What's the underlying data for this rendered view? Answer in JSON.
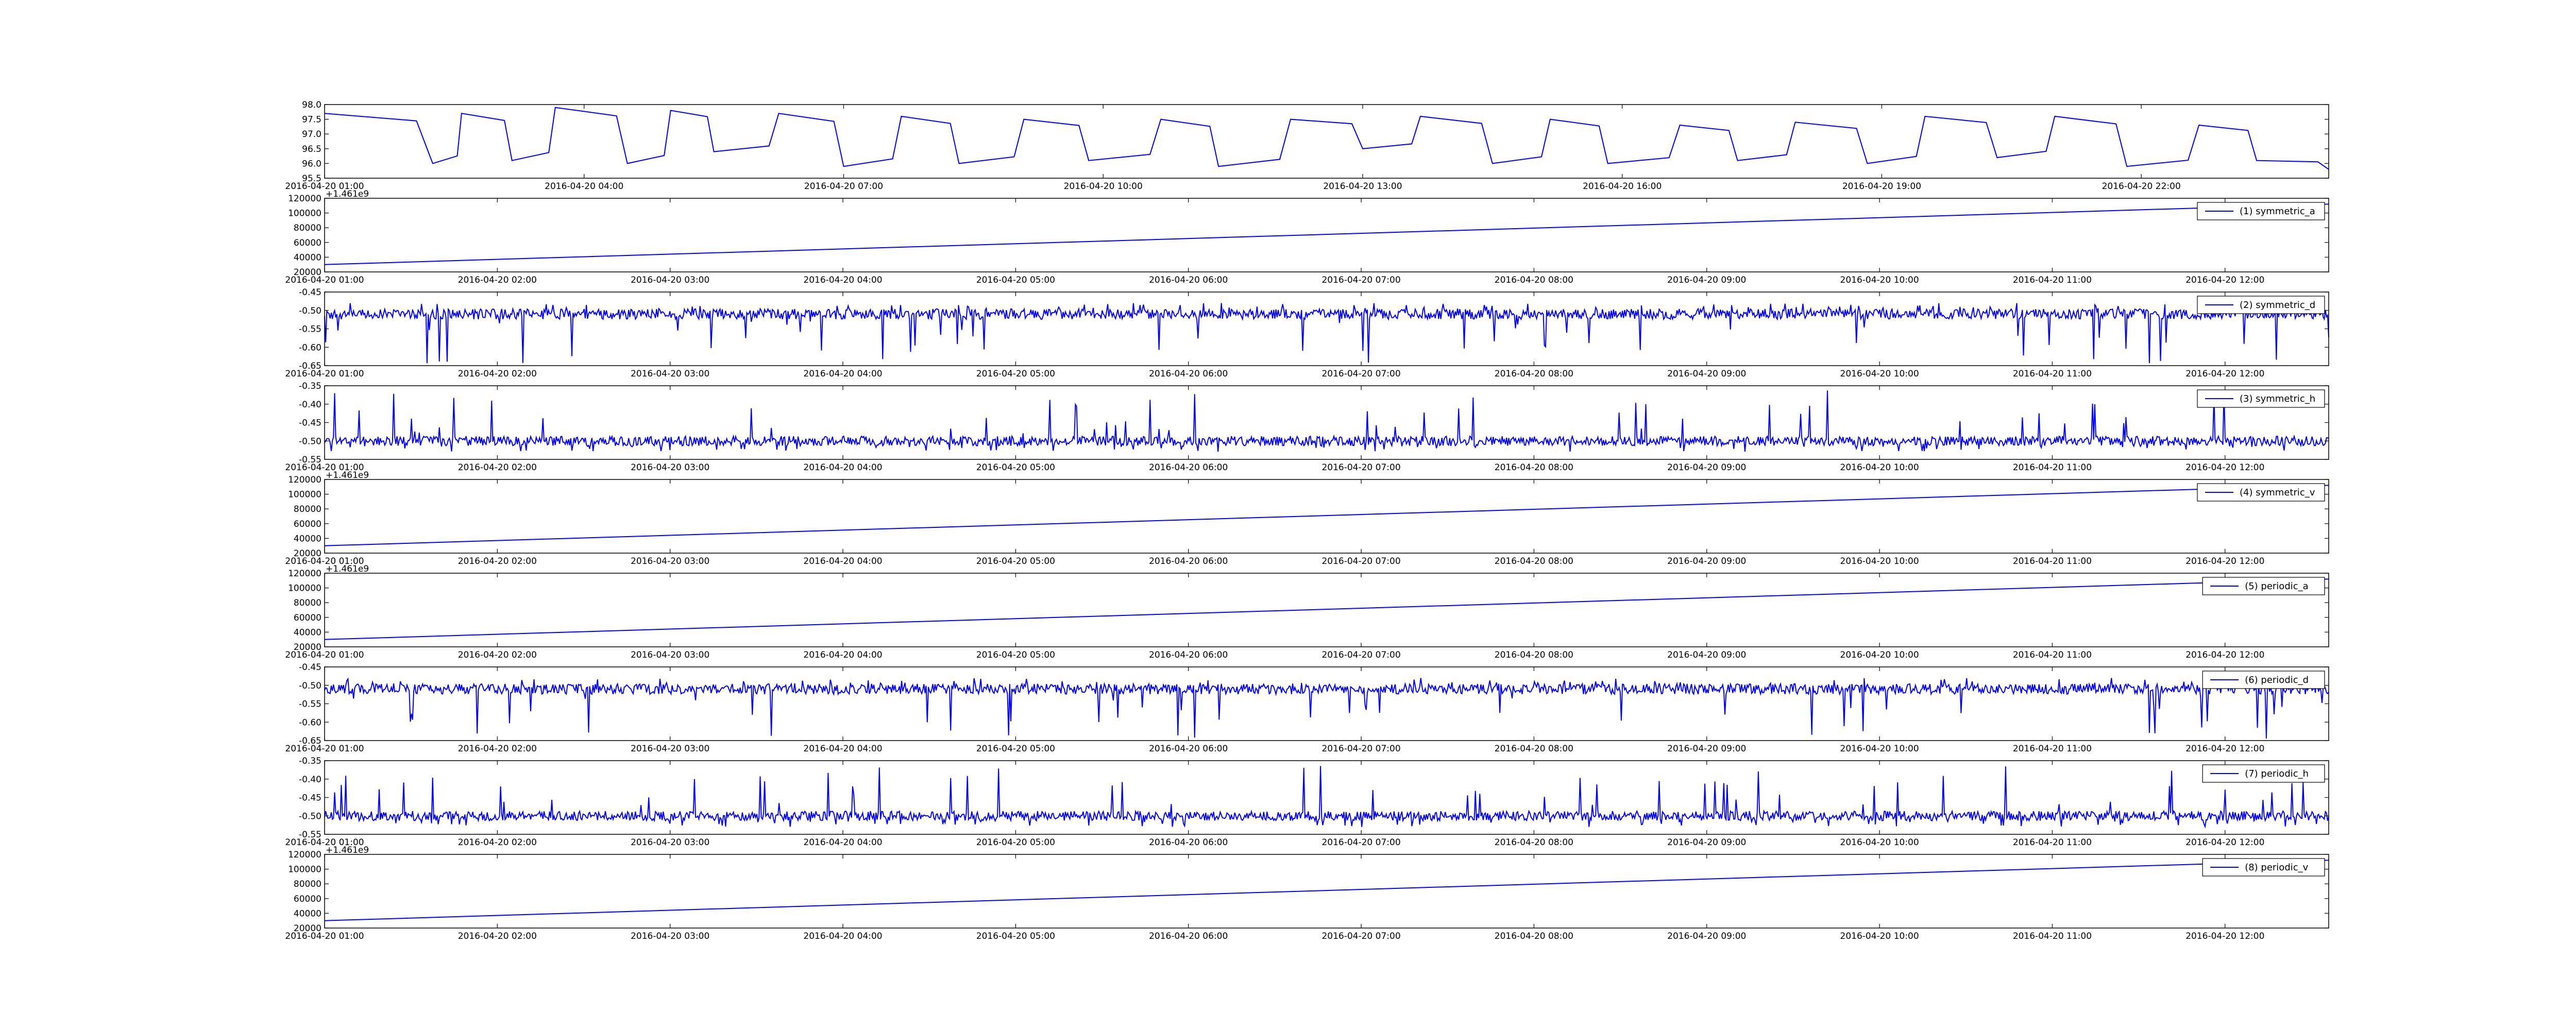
{
  "chart_data": [
    {
      "type": "line",
      "x_tick_labels": [
        "2016-04-20 01:00",
        "2016-04-20 04:00",
        "2016-04-20 07:00",
        "2016-04-20 10:00",
        "2016-04-20 13:00",
        "2016-04-20 16:00",
        "2016-04-20 19:00",
        "2016-04-20 22:00"
      ],
      "x_range": [
        "2016-04-20 01:00",
        "2016-04-21 00:10"
      ],
      "ylim": [
        95.5,
        98.0
      ],
      "y_tick_labels": [
        "95.5",
        "96.0",
        "96.5",
        "97.0",
        "97.5",
        "98.0"
      ],
      "offset_label": "",
      "legend": null,
      "series": [
        {
          "color": "#0000ff",
          "x": [
            "2016-04-20 01:00",
            "2016-04-20 02:15",
            "2016-04-20 02:35",
            "2016-04-20 03:10",
            "2016-04-20 03:40",
            "2016-04-20 04:30",
            "2016-04-20 05:00",
            "2016-04-20 05:30",
            "2016-04-20 06:15",
            "2016-04-20 07:00",
            "2016-04-20 07:40",
            "2016-04-20 08:20",
            "2016-04-20 09:05",
            "2016-04-20 09:50",
            "2016-04-20 10:40",
            "2016-04-20 11:20",
            "2016-04-20 12:10",
            "2016-04-20 13:00",
            "2016-04-20 13:40",
            "2016-04-20 14:30",
            "2016-04-20 15:10",
            "2016-04-20 15:50",
            "2016-04-20 16:40",
            "2016-04-20 17:20",
            "2016-04-20 18:00",
            "2016-04-20 18:50",
            "2016-04-20 19:30",
            "2016-04-20 20:20",
            "2016-04-20 21:00",
            "2016-04-20 21:50",
            "2016-04-20 22:40",
            "2016-04-20 23:20",
            "2016-04-21 00:10"
          ],
          "y": [
            97.7,
            96.0,
            97.7,
            96.1,
            97.9,
            96.0,
            97.8,
            96.4,
            97.7,
            95.9,
            97.6,
            96.0,
            97.5,
            96.1,
            97.5,
            95.9,
            97.5,
            96.5,
            97.6,
            96.0,
            97.5,
            96.0,
            97.3,
            96.1,
            97.4,
            96.0,
            97.6,
            96.2,
            97.6,
            95.9,
            97.3,
            96.1,
            95.8
          ]
        }
      ]
    },
    {
      "type": "line",
      "x_tick_labels": [
        "2016-04-20 01:00",
        "2016-04-20 02:00",
        "2016-04-20 03:00",
        "2016-04-20 04:00",
        "2016-04-20 05:00",
        "2016-04-20 06:00",
        "2016-04-20 07:00",
        "2016-04-20 08:00",
        "2016-04-20 09:00",
        "2016-04-20 10:00",
        "2016-04-20 11:00",
        "2016-04-20 12:00"
      ],
      "x_range": [
        "2016-04-20 01:00",
        "2016-04-20 12:36"
      ],
      "ylim": [
        20000,
        120000
      ],
      "y_tick_labels": [
        "20000",
        "40000",
        "60000",
        "80000",
        "100000",
        "120000"
      ],
      "offset_label": "+1.461e9",
      "legend": "(1) symmetric_a",
      "series": [
        {
          "color": "#0000ff",
          "x": [
            "2016-04-20 01:00",
            "2016-04-20 12:36"
          ],
          "y": [
            30000,
            112000
          ]
        }
      ]
    },
    {
      "type": "line",
      "x_tick_labels": [
        "2016-04-20 01:00",
        "2016-04-20 02:00",
        "2016-04-20 03:00",
        "2016-04-20 04:00",
        "2016-04-20 05:00",
        "2016-04-20 06:00",
        "2016-04-20 07:00",
        "2016-04-20 08:00",
        "2016-04-20 09:00",
        "2016-04-20 10:00",
        "2016-04-20 11:00",
        "2016-04-20 12:00"
      ],
      "x_range": [
        "2016-04-20 01:00",
        "2016-04-20 12:36"
      ],
      "ylim": [
        -0.65,
        -0.45
      ],
      "y_tick_labels": [
        "-0.65",
        "-0.60",
        "-0.55",
        "-0.50",
        "-0.45"
      ],
      "offset_label": "",
      "legend": "(2) symmetric_d",
      "series": [
        {
          "color": "#0000ff",
          "x": [
            "2016-04-20 01:00",
            "2016-04-20 12:36"
          ],
          "y": [
            -0.51,
            -0.51
          ],
          "noise": 0.014,
          "spike": 0.12,
          "spike_dir": -1
        }
      ]
    },
    {
      "type": "line",
      "x_tick_labels": [
        "2016-04-20 01:00",
        "2016-04-20 02:00",
        "2016-04-20 03:00",
        "2016-04-20 04:00",
        "2016-04-20 05:00",
        "2016-04-20 06:00",
        "2016-04-20 07:00",
        "2016-04-20 08:00",
        "2016-04-20 09:00",
        "2016-04-20 10:00",
        "2016-04-20 11:00",
        "2016-04-20 12:00"
      ],
      "x_range": [
        "2016-04-20 01:00",
        "2016-04-20 12:36"
      ],
      "ylim": [
        -0.55,
        -0.35
      ],
      "y_tick_labels": [
        "-0.55",
        "-0.50",
        "-0.45",
        "-0.40",
        "-0.35"
      ],
      "offset_label": "",
      "legend": "(3) symmetric_h",
      "series": [
        {
          "color": "#0000ff",
          "x": [
            "2016-04-20 01:00",
            "2016-04-20 12:36"
          ],
          "y": [
            -0.5,
            -0.5
          ],
          "noise": 0.013,
          "spike": 0.12,
          "spike_dir": 1
        }
      ]
    },
    {
      "type": "line",
      "x_tick_labels": [
        "2016-04-20 01:00",
        "2016-04-20 02:00",
        "2016-04-20 03:00",
        "2016-04-20 04:00",
        "2016-04-20 05:00",
        "2016-04-20 06:00",
        "2016-04-20 07:00",
        "2016-04-20 08:00",
        "2016-04-20 09:00",
        "2016-04-20 10:00",
        "2016-04-20 11:00",
        "2016-04-20 12:00"
      ],
      "x_range": [
        "2016-04-20 01:00",
        "2016-04-20 12:36"
      ],
      "ylim": [
        20000,
        120000
      ],
      "y_tick_labels": [
        "20000",
        "40000",
        "60000",
        "80000",
        "100000",
        "120000"
      ],
      "offset_label": "+1.461e9",
      "legend": "(4) symmetric_v",
      "series": [
        {
          "color": "#0000ff",
          "x": [
            "2016-04-20 01:00",
            "2016-04-20 12:36"
          ],
          "y": [
            30000,
            112000
          ]
        }
      ]
    },
    {
      "type": "line",
      "x_tick_labels": [
        "2016-04-20 01:00",
        "2016-04-20 02:00",
        "2016-04-20 03:00",
        "2016-04-20 04:00",
        "2016-04-20 05:00",
        "2016-04-20 06:00",
        "2016-04-20 07:00",
        "2016-04-20 08:00",
        "2016-04-20 09:00",
        "2016-04-20 10:00",
        "2016-04-20 11:00",
        "2016-04-20 12:00"
      ],
      "x_range": [
        "2016-04-20 01:00",
        "2016-04-20 12:36"
      ],
      "ylim": [
        20000,
        120000
      ],
      "y_tick_labels": [
        "20000",
        "40000",
        "60000",
        "80000",
        "100000",
        "120000"
      ],
      "offset_label": "+1.461e9",
      "legend": "(5) periodic_a",
      "series": [
        {
          "color": "#0000ff",
          "x": [
            "2016-04-20 01:00",
            "2016-04-20 12:36"
          ],
          "y": [
            30000,
            112000
          ]
        }
      ]
    },
    {
      "type": "line",
      "x_tick_labels": [
        "2016-04-20 01:00",
        "2016-04-20 02:00",
        "2016-04-20 03:00",
        "2016-04-20 04:00",
        "2016-04-20 05:00",
        "2016-04-20 06:00",
        "2016-04-20 07:00",
        "2016-04-20 08:00",
        "2016-04-20 09:00",
        "2016-04-20 10:00",
        "2016-04-20 11:00",
        "2016-04-20 12:00"
      ],
      "x_range": [
        "2016-04-20 01:00",
        "2016-04-20 12:36"
      ],
      "ylim": [
        -0.65,
        -0.45
      ],
      "y_tick_labels": [
        "-0.65",
        "-0.60",
        "-0.55",
        "-0.50",
        "-0.45"
      ],
      "offset_label": "",
      "legend": "(6) periodic_d",
      "series": [
        {
          "color": "#0000ff",
          "x": [
            "2016-04-20 01:00",
            "2016-04-20 12:36"
          ],
          "y": [
            -0.51,
            -0.51
          ],
          "noise": 0.014,
          "spike": 0.12,
          "spike_dir": -1
        }
      ]
    },
    {
      "type": "line",
      "x_tick_labels": [
        "2016-04-20 01:00",
        "2016-04-20 02:00",
        "2016-04-20 03:00",
        "2016-04-20 04:00",
        "2016-04-20 05:00",
        "2016-04-20 06:00",
        "2016-04-20 07:00",
        "2016-04-20 08:00",
        "2016-04-20 09:00",
        "2016-04-20 10:00",
        "2016-04-20 11:00",
        "2016-04-20 12:00"
      ],
      "x_range": [
        "2016-04-20 01:00",
        "2016-04-20 12:36"
      ],
      "ylim": [
        -0.55,
        -0.35
      ],
      "y_tick_labels": [
        "-0.55",
        "-0.50",
        "-0.45",
        "-0.40",
        "-0.35"
      ],
      "offset_label": "",
      "legend": "(7) periodic_h",
      "series": [
        {
          "color": "#0000ff",
          "x": [
            "2016-04-20 01:00",
            "2016-04-20 12:36"
          ],
          "y": [
            -0.5,
            -0.5
          ],
          "noise": 0.013,
          "spike": 0.12,
          "spike_dir": 1
        }
      ]
    },
    {
      "type": "line",
      "x_tick_labels": [
        "2016-04-20 01:00",
        "2016-04-20 02:00",
        "2016-04-20 03:00",
        "2016-04-20 04:00",
        "2016-04-20 05:00",
        "2016-04-20 06:00",
        "2016-04-20 07:00",
        "2016-04-20 08:00",
        "2016-04-20 09:00",
        "2016-04-20 10:00",
        "2016-04-20 11:00",
        "2016-04-20 12:00"
      ],
      "x_range": [
        "2016-04-20 01:00",
        "2016-04-20 12:36"
      ],
      "ylim": [
        20000,
        120000
      ],
      "y_tick_labels": [
        "20000",
        "40000",
        "60000",
        "80000",
        "100000",
        "120000"
      ],
      "offset_label": "+1.461e9",
      "legend": "(8) periodic_v",
      "series": [
        {
          "color": "#0000ff",
          "x": [
            "2016-04-20 01:00",
            "2016-04-20 12:36"
          ],
          "y": [
            30000,
            112000
          ]
        }
      ]
    }
  ]
}
